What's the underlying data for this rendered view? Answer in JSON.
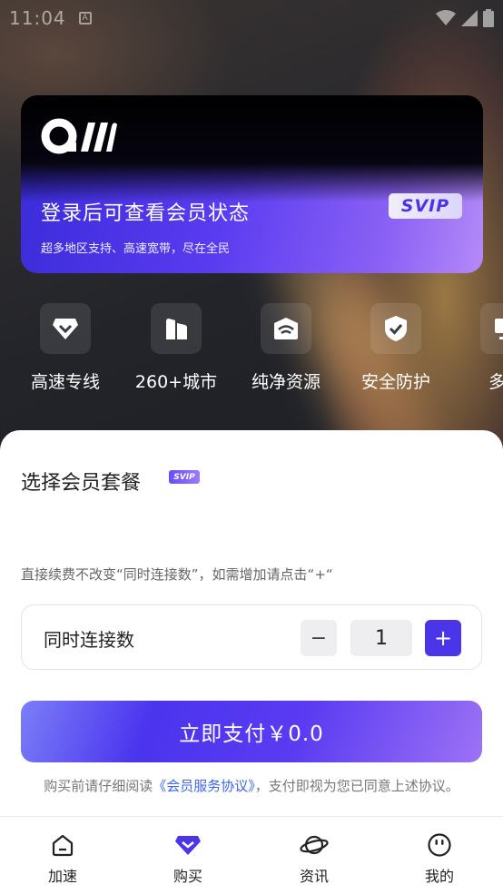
{
  "status_bar": {
    "time": "11:04",
    "notif_letter": "A"
  },
  "member_card": {
    "title": "登录后可查看会员状态",
    "subtitle": "超多地区支持、高速宽带，尽在全民",
    "badge": "SVIP"
  },
  "features": [
    {
      "label": "高速专线",
      "icon": "gem-down-icon"
    },
    {
      "label": "260+城市",
      "icon": "city-buildings-icon"
    },
    {
      "label": "纯净资源",
      "icon": "wifi-icon"
    },
    {
      "label": "安全防护",
      "icon": "shield-check-icon"
    },
    {
      "label": "多端",
      "icon": "monitor-icon"
    }
  ],
  "plan": {
    "title": "选择会员套餐",
    "badge": "SVIP",
    "renew_note": "直接续费不改变“同时连接数”，如需增加请点击“+“",
    "connections_label": "同时连接数",
    "minus": "−",
    "value": "1",
    "plus": "+",
    "pay_label": "立即支付￥0.0",
    "agreement_prefix": "购买前请仔细阅读",
    "agreement_link": "《会员服务协议》",
    "agreement_suffix": "，支付即视为您已同意上述协议。"
  },
  "tabs": [
    {
      "label": "加速",
      "icon": "home-icon"
    },
    {
      "label": "购买",
      "icon": "diamond-icon"
    },
    {
      "label": "资讯",
      "icon": "planet-icon"
    },
    {
      "label": "我的",
      "icon": "smiley-icon"
    }
  ],
  "colors": {
    "accent": "#4b35e8",
    "link": "#3d64e8"
  }
}
